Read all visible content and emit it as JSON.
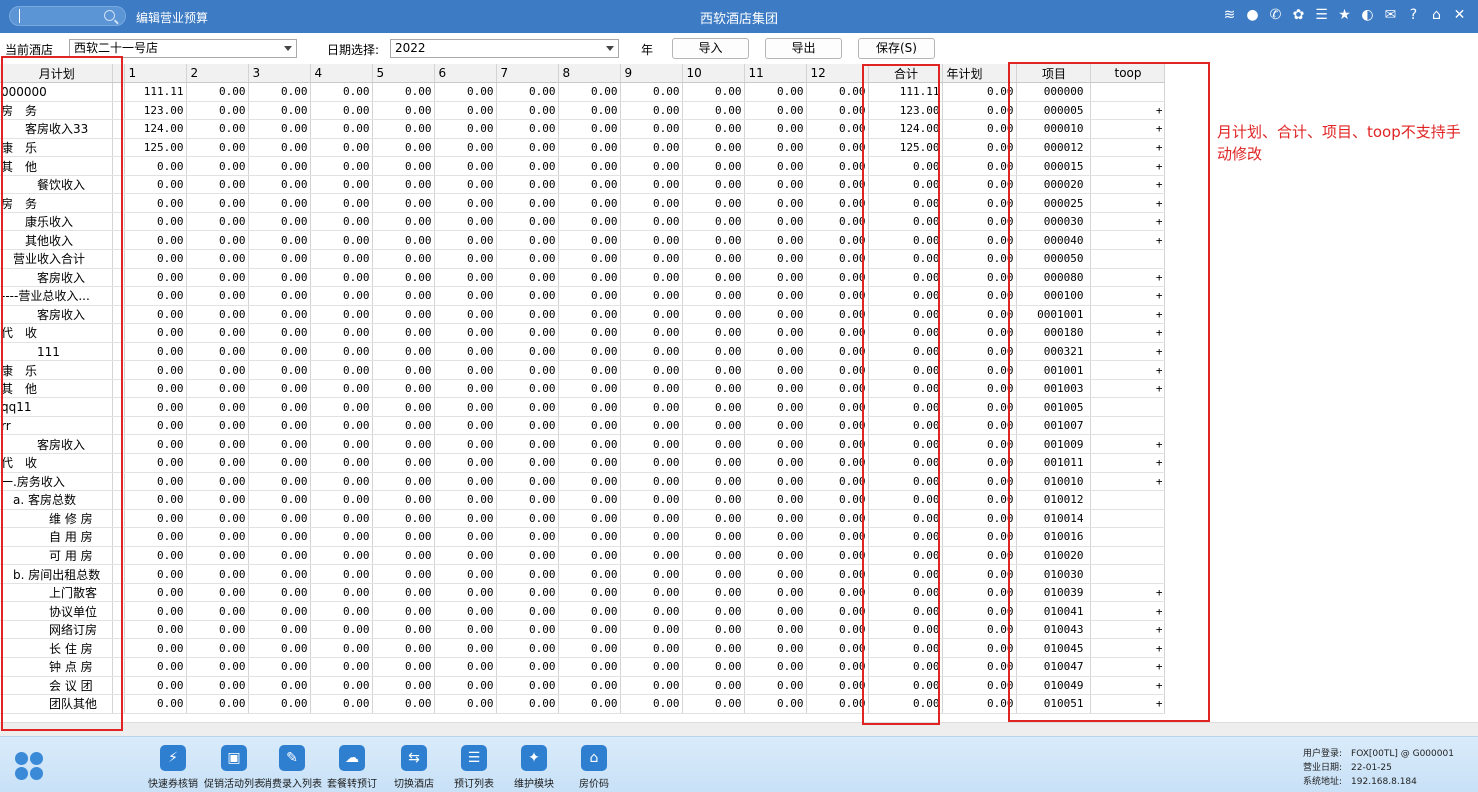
{
  "header": {
    "edit_title": "编辑营业预算",
    "app_title": "西软酒店集团",
    "icons": [
      "wifi-icon",
      "chat-icon",
      "phone-icon",
      "palette-icon",
      "menu-icon",
      "star-icon",
      "theme-icon",
      "mail-icon",
      "help-icon",
      "home-icon",
      "close-icon"
    ]
  },
  "toolbar": {
    "hotel_label": "当前酒店",
    "hotel_value": "西软二十一号店",
    "date_label": "日期选择:",
    "date_value": "2022",
    "year_label": "年",
    "import_label": "导入",
    "export_label": "导出",
    "save_label": "保存(S)"
  },
  "grid": {
    "headers": [
      "月计划",
      "1",
      "2",
      "3",
      "4",
      "5",
      "6",
      "7",
      "8",
      "9",
      "10",
      "11",
      "12",
      "合计",
      "年计划",
      "项目",
      "toop"
    ],
    "rows": [
      {
        "name": "000000",
        "vals": [
          "111.11",
          "0.00",
          "0.00",
          "0.00",
          "0.00",
          "0.00",
          "0.00",
          "0.00",
          "0.00",
          "0.00",
          "0.00",
          "0.00"
        ],
        "total": "111.11",
        "year": "0.00",
        "code": "000000",
        "toop": ""
      },
      {
        "name": "房　务",
        "vals": [
          "123.00",
          "0.00",
          "0.00",
          "0.00",
          "0.00",
          "0.00",
          "0.00",
          "0.00",
          "0.00",
          "0.00",
          "0.00",
          "0.00"
        ],
        "total": "123.00",
        "year": "0.00",
        "code": "000005",
        "toop": "+"
      },
      {
        "name": "　　客房收入33",
        "vals": [
          "124.00",
          "0.00",
          "0.00",
          "0.00",
          "0.00",
          "0.00",
          "0.00",
          "0.00",
          "0.00",
          "0.00",
          "0.00",
          "0.00"
        ],
        "total": "124.00",
        "year": "0.00",
        "code": "000010",
        "toop": "+"
      },
      {
        "name": "康　乐",
        "vals": [
          "125.00",
          "0.00",
          "0.00",
          "0.00",
          "0.00",
          "0.00",
          "0.00",
          "0.00",
          "0.00",
          "0.00",
          "0.00",
          "0.00"
        ],
        "total": "125.00",
        "year": "0.00",
        "code": "000012",
        "toop": "+"
      },
      {
        "name": "其　他",
        "vals": [
          "0.00",
          "0.00",
          "0.00",
          "0.00",
          "0.00",
          "0.00",
          "0.00",
          "0.00",
          "0.00",
          "0.00",
          "0.00",
          "0.00"
        ],
        "total": "0.00",
        "year": "0.00",
        "code": "000015",
        "toop": "+"
      },
      {
        "name": "　　　餐饮收入",
        "vals": [
          "0.00",
          "0.00",
          "0.00",
          "0.00",
          "0.00",
          "0.00",
          "0.00",
          "0.00",
          "0.00",
          "0.00",
          "0.00",
          "0.00"
        ],
        "total": "0.00",
        "year": "0.00",
        "code": "000020",
        "toop": "+"
      },
      {
        "name": "房　务",
        "vals": [
          "0.00",
          "0.00",
          "0.00",
          "0.00",
          "0.00",
          "0.00",
          "0.00",
          "0.00",
          "0.00",
          "0.00",
          "0.00",
          "0.00"
        ],
        "total": "0.00",
        "year": "0.00",
        "code": "000025",
        "toop": "+"
      },
      {
        "name": "　　康乐收入",
        "vals": [
          "0.00",
          "0.00",
          "0.00",
          "0.00",
          "0.00",
          "0.00",
          "0.00",
          "0.00",
          "0.00",
          "0.00",
          "0.00",
          "0.00"
        ],
        "total": "0.00",
        "year": "0.00",
        "code": "000030",
        "toop": "+"
      },
      {
        "name": "　　其他收入",
        "vals": [
          "0.00",
          "0.00",
          "0.00",
          "0.00",
          "0.00",
          "0.00",
          "0.00",
          "0.00",
          "0.00",
          "0.00",
          "0.00",
          "0.00"
        ],
        "total": "0.00",
        "year": "0.00",
        "code": "000040",
        "toop": "+"
      },
      {
        "name": "　营业收入合计",
        "vals": [
          "0.00",
          "0.00",
          "0.00",
          "0.00",
          "0.00",
          "0.00",
          "0.00",
          "0.00",
          "0.00",
          "0.00",
          "0.00",
          "0.00"
        ],
        "total": "0.00",
        "year": "0.00",
        "code": "000050",
        "toop": ""
      },
      {
        "name": "　　　客房收入",
        "vals": [
          "0.00",
          "0.00",
          "0.00",
          "0.00",
          "0.00",
          "0.00",
          "0.00",
          "0.00",
          "0.00",
          "0.00",
          "0.00",
          "0.00"
        ],
        "total": "0.00",
        "year": "0.00",
        "code": "000080",
        "toop": "+"
      },
      {
        "name": "----营业总收入...",
        "vals": [
          "0.00",
          "0.00",
          "0.00",
          "0.00",
          "0.00",
          "0.00",
          "0.00",
          "0.00",
          "0.00",
          "0.00",
          "0.00",
          "0.00"
        ],
        "total": "0.00",
        "year": "0.00",
        "code": "000100",
        "toop": "+"
      },
      {
        "name": "　　　客房收入",
        "vals": [
          "0.00",
          "0.00",
          "0.00",
          "0.00",
          "0.00",
          "0.00",
          "0.00",
          "0.00",
          "0.00",
          "0.00",
          "0.00",
          "0.00"
        ],
        "total": "0.00",
        "year": "0.00",
        "code": "0001001",
        "toop": "+"
      },
      {
        "name": "代　收",
        "vals": [
          "0.00",
          "0.00",
          "0.00",
          "0.00",
          "0.00",
          "0.00",
          "0.00",
          "0.00",
          "0.00",
          "0.00",
          "0.00",
          "0.00"
        ],
        "total": "0.00",
        "year": "0.00",
        "code": "000180",
        "toop": "+"
      },
      {
        "name": "　　　111",
        "vals": [
          "0.00",
          "0.00",
          "0.00",
          "0.00",
          "0.00",
          "0.00",
          "0.00",
          "0.00",
          "0.00",
          "0.00",
          "0.00",
          "0.00"
        ],
        "total": "0.00",
        "year": "0.00",
        "code": "000321",
        "toop": "+"
      },
      {
        "name": "康　乐",
        "vals": [
          "0.00",
          "0.00",
          "0.00",
          "0.00",
          "0.00",
          "0.00",
          "0.00",
          "0.00",
          "0.00",
          "0.00",
          "0.00",
          "0.00"
        ],
        "total": "0.00",
        "year": "0.00",
        "code": "001001",
        "toop": "+"
      },
      {
        "name": "其　他",
        "vals": [
          "0.00",
          "0.00",
          "0.00",
          "0.00",
          "0.00",
          "0.00",
          "0.00",
          "0.00",
          "0.00",
          "0.00",
          "0.00",
          "0.00"
        ],
        "total": "0.00",
        "year": "0.00",
        "code": "001003",
        "toop": "+"
      },
      {
        "name": "qq11",
        "vals": [
          "0.00",
          "0.00",
          "0.00",
          "0.00",
          "0.00",
          "0.00",
          "0.00",
          "0.00",
          "0.00",
          "0.00",
          "0.00",
          "0.00"
        ],
        "total": "0.00",
        "year": "0.00",
        "code": "001005",
        "toop": ""
      },
      {
        "name": "rr",
        "vals": [
          "0.00",
          "0.00",
          "0.00",
          "0.00",
          "0.00",
          "0.00",
          "0.00",
          "0.00",
          "0.00",
          "0.00",
          "0.00",
          "0.00"
        ],
        "total": "0.00",
        "year": "0.00",
        "code": "001007",
        "toop": ""
      },
      {
        "name": "　　　客房收入",
        "vals": [
          "0.00",
          "0.00",
          "0.00",
          "0.00",
          "0.00",
          "0.00",
          "0.00",
          "0.00",
          "0.00",
          "0.00",
          "0.00",
          "0.00"
        ],
        "total": "0.00",
        "year": "0.00",
        "code": "001009",
        "toop": "+"
      },
      {
        "name": "代　收",
        "vals": [
          "0.00",
          "0.00",
          "0.00",
          "0.00",
          "0.00",
          "0.00",
          "0.00",
          "0.00",
          "0.00",
          "0.00",
          "0.00",
          "0.00"
        ],
        "total": "0.00",
        "year": "0.00",
        "code": "001011",
        "toop": "+"
      },
      {
        "name": "一.房务收入",
        "vals": [
          "0.00",
          "0.00",
          "0.00",
          "0.00",
          "0.00",
          "0.00",
          "0.00",
          "0.00",
          "0.00",
          "0.00",
          "0.00",
          "0.00"
        ],
        "total": "0.00",
        "year": "0.00",
        "code": "010010",
        "toop": "+"
      },
      {
        "name": "　a. 客房总数",
        "vals": [
          "0.00",
          "0.00",
          "0.00",
          "0.00",
          "0.00",
          "0.00",
          "0.00",
          "0.00",
          "0.00",
          "0.00",
          "0.00",
          "0.00"
        ],
        "total": "0.00",
        "year": "0.00",
        "code": "010012",
        "toop": ""
      },
      {
        "name": "　　　　维 修 房",
        "vals": [
          "0.00",
          "0.00",
          "0.00",
          "0.00",
          "0.00",
          "0.00",
          "0.00",
          "0.00",
          "0.00",
          "0.00",
          "0.00",
          "0.00"
        ],
        "total": "0.00",
        "year": "0.00",
        "code": "010014",
        "toop": ""
      },
      {
        "name": "　　　　自 用 房",
        "vals": [
          "0.00",
          "0.00",
          "0.00",
          "0.00",
          "0.00",
          "0.00",
          "0.00",
          "0.00",
          "0.00",
          "0.00",
          "0.00",
          "0.00"
        ],
        "total": "0.00",
        "year": "0.00",
        "code": "010016",
        "toop": ""
      },
      {
        "name": "　　　　可 用 房",
        "vals": [
          "0.00",
          "0.00",
          "0.00",
          "0.00",
          "0.00",
          "0.00",
          "0.00",
          "0.00",
          "0.00",
          "0.00",
          "0.00",
          "0.00"
        ],
        "total": "0.00",
        "year": "0.00",
        "code": "010020",
        "toop": ""
      },
      {
        "name": "　b. 房间出租总数",
        "vals": [
          "0.00",
          "0.00",
          "0.00",
          "0.00",
          "0.00",
          "0.00",
          "0.00",
          "0.00",
          "0.00",
          "0.00",
          "0.00",
          "0.00"
        ],
        "total": "0.00",
        "year": "0.00",
        "code": "010030",
        "toop": ""
      },
      {
        "name": "　　　　上门散客",
        "vals": [
          "0.00",
          "0.00",
          "0.00",
          "0.00",
          "0.00",
          "0.00",
          "0.00",
          "0.00",
          "0.00",
          "0.00",
          "0.00",
          "0.00"
        ],
        "total": "0.00",
        "year": "0.00",
        "code": "010039",
        "toop": "+"
      },
      {
        "name": "　　　　协议单位",
        "vals": [
          "0.00",
          "0.00",
          "0.00",
          "0.00",
          "0.00",
          "0.00",
          "0.00",
          "0.00",
          "0.00",
          "0.00",
          "0.00",
          "0.00"
        ],
        "total": "0.00",
        "year": "0.00",
        "code": "010041",
        "toop": "+"
      },
      {
        "name": "　　　　网络订房",
        "vals": [
          "0.00",
          "0.00",
          "0.00",
          "0.00",
          "0.00",
          "0.00",
          "0.00",
          "0.00",
          "0.00",
          "0.00",
          "0.00",
          "0.00"
        ],
        "total": "0.00",
        "year": "0.00",
        "code": "010043",
        "toop": "+"
      },
      {
        "name": "　　　　长 住 房",
        "vals": [
          "0.00",
          "0.00",
          "0.00",
          "0.00",
          "0.00",
          "0.00",
          "0.00",
          "0.00",
          "0.00",
          "0.00",
          "0.00",
          "0.00"
        ],
        "total": "0.00",
        "year": "0.00",
        "code": "010045",
        "toop": "+"
      },
      {
        "name": "　　　　钟 点 房",
        "vals": [
          "0.00",
          "0.00",
          "0.00",
          "0.00",
          "0.00",
          "0.00",
          "0.00",
          "0.00",
          "0.00",
          "0.00",
          "0.00",
          "0.00"
        ],
        "total": "0.00",
        "year": "0.00",
        "code": "010047",
        "toop": "+"
      },
      {
        "name": "　　　　会 议 团",
        "vals": [
          "0.00",
          "0.00",
          "0.00",
          "0.00",
          "0.00",
          "0.00",
          "0.00",
          "0.00",
          "0.00",
          "0.00",
          "0.00",
          "0.00"
        ],
        "total": "0.00",
        "year": "0.00",
        "code": "010049",
        "toop": "+"
      },
      {
        "name": "　　　　团队其他",
        "vals": [
          "0.00",
          "0.00",
          "0.00",
          "0.00",
          "0.00",
          "0.00",
          "0.00",
          "0.00",
          "0.00",
          "0.00",
          "0.00",
          "0.00"
        ],
        "total": "0.00",
        "year": "0.00",
        "code": "010051",
        "toop": "+"
      }
    ]
  },
  "annotation": {
    "note": "月计划、合计、项目、toop不支持手动修改",
    "color": "#e02424"
  },
  "dock": {
    "items": [
      {
        "label": "快速券核销",
        "icon": "lightning-icon",
        "glyph": "⚡"
      },
      {
        "label": "促销活动列表",
        "icon": "clipboard-icon",
        "glyph": "▣"
      },
      {
        "label": "消费录入列表",
        "icon": "document-edit-icon",
        "glyph": "✎"
      },
      {
        "label": "套餐转预订",
        "icon": "package-icon",
        "glyph": "☁"
      },
      {
        "label": "切换酒店",
        "icon": "switch-icon",
        "glyph": "⇆"
      },
      {
        "label": "预订列表",
        "icon": "list-icon",
        "glyph": "☰"
      },
      {
        "label": "维护模块",
        "icon": "wrench-icon",
        "glyph": "✦"
      },
      {
        "label": "房价码",
        "icon": "house-icon",
        "glyph": "⌂"
      }
    ]
  },
  "sysinfo": {
    "user": "用户登录:　FOX[00TL] @ G000001",
    "biz_date": "营业日期:　22-01-25",
    "address": "系统地址:　192.168.8.184"
  },
  "colors": {
    "topbar": "#3d7bc4",
    "accent": "#2f7fd1",
    "annotation": "#e02424"
  }
}
